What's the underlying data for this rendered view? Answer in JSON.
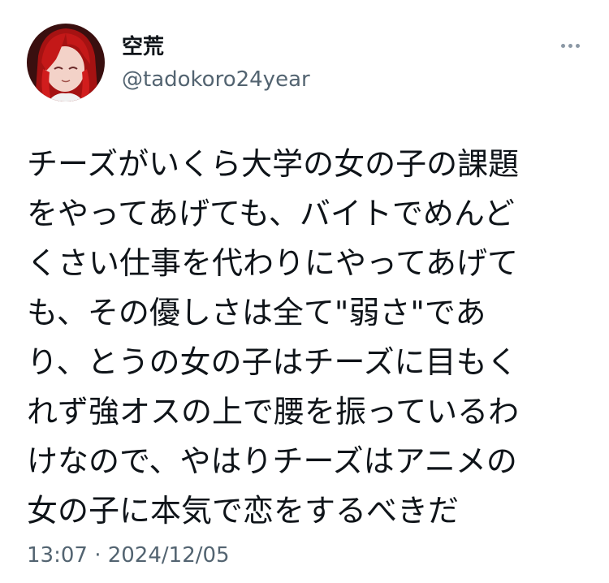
{
  "author": {
    "display_name": "空荒",
    "handle": "@tadokoro24year",
    "avatar_icon": "profile-avatar"
  },
  "header": {
    "more_icon": "more-horizontal-icon"
  },
  "tweet": {
    "lines": [
      "チーズがいくら大学の女の子の課題",
      "をやってあげても、バイトでめんど",
      "くさい仕事を代わりにやってあげて",
      "も、その優しさは全て\"弱さ\"であ",
      "り、とうの女の子はチーズに目もく",
      "れず強オスの上で腰を振っているわ",
      "けなので、やはりチーズはアニメの",
      "女の子に本気で恋をするべきだ"
    ]
  },
  "meta": {
    "timestamp": "13:07 · 2024/12/05"
  },
  "colors": {
    "text": "#0f1419",
    "secondary": "#536471",
    "avatar_bg": "#3a0f0f",
    "hair": "#b81414"
  }
}
